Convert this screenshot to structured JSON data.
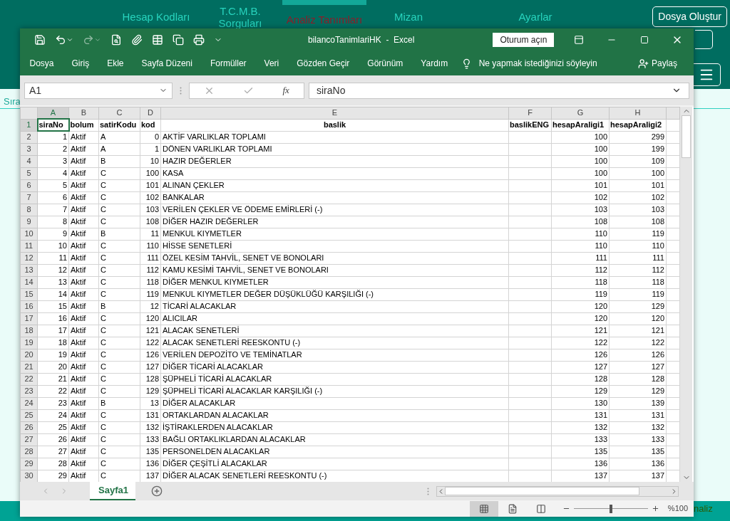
{
  "background_app": {
    "nav": [
      {
        "label": "Hesap Kodları",
        "selected": false
      },
      {
        "label": "T.C.M.B. Sorguları",
        "selected": false
      },
      {
        "label": "Analiz Tanımları",
        "selected": true
      },
      {
        "label": "Mizan",
        "selected": false
      },
      {
        "label": "Ayarlar",
        "selected": false
      }
    ],
    "create_button": "Dosya Oluştur",
    "side_text": "Sıra",
    "bottom_text": "naliz"
  },
  "window": {
    "title": "bilancoTanimlariHK  -  Excel",
    "sign_in": "Oturum açın",
    "ribbon_tabs": [
      "Dosya",
      "Giriş",
      "Ekle",
      "Sayfa Düzeni",
      "Formüller",
      "Veri",
      "Gözden Geçir",
      "Görünüm",
      "Yardım"
    ],
    "tell_me": "Ne yapmak istediğinizi söyleyin",
    "share": "Paylaş"
  },
  "formula_bar": {
    "name_box": "A1",
    "function_button": "fx",
    "value": "siraNo"
  },
  "sheet": {
    "header_row": {
      "num": "1",
      "selected": true
    },
    "columns": [
      {
        "letter": "A",
        "heading": "siraNo",
        "kind": "number",
        "selected": true
      },
      {
        "letter": "B",
        "heading": "bolum",
        "kind": "text",
        "selected": false
      },
      {
        "letter": "C",
        "heading": "satirKodu",
        "kind": "text",
        "selected": false
      },
      {
        "letter": "D",
        "heading": "kod",
        "kind": "number",
        "selected": false
      },
      {
        "letter": "E",
        "heading": "baslik",
        "kind": "title",
        "selected": false
      },
      {
        "letter": "F",
        "heading": "baslikENG",
        "kind": "text",
        "selected": false
      },
      {
        "letter": "G",
        "heading": "hesapAraligi1",
        "kind": "number",
        "selected": false
      },
      {
        "letter": "H",
        "heading": "hesapAraligi2",
        "kind": "number",
        "selected": false
      }
    ],
    "rows": [
      {
        "num": "2",
        "cells": [
          "1",
          "Aktif",
          "A",
          "0",
          "AKTİF VARLIKLAR TOPLAMI",
          null,
          "100",
          "299"
        ]
      },
      {
        "num": "3",
        "cells": [
          "2",
          "Aktif",
          "A",
          "1",
          "DÖNEN VARLIKLAR TOPLAMI",
          null,
          "100",
          "199"
        ]
      },
      {
        "num": "4",
        "cells": [
          "3",
          "Aktif",
          "B",
          "10",
          "HAZIR DEĞERLER",
          null,
          "100",
          "109"
        ]
      },
      {
        "num": "5",
        "cells": [
          "4",
          "Aktif",
          "C",
          "100",
          "KASA",
          null,
          "100",
          "100"
        ]
      },
      {
        "num": "6",
        "cells": [
          "5",
          "Aktif",
          "C",
          "101",
          "ALINAN ÇEKLER",
          null,
          "101",
          "101"
        ]
      },
      {
        "num": "7",
        "cells": [
          "6",
          "Aktif",
          "C",
          "102",
          "BANKALAR",
          null,
          "102",
          "102"
        ]
      },
      {
        "num": "8",
        "cells": [
          "7",
          "Aktif",
          "C",
          "103",
          "VERİLEN ÇEKLER VE ÖDEME EMİRLERİ (-)",
          null,
          "103",
          "103"
        ]
      },
      {
        "num": "9",
        "cells": [
          "8",
          "Aktif",
          "C",
          "108",
          "DİĞER HAZIR DEĞERLER",
          null,
          "108",
          "108"
        ]
      },
      {
        "num": "10",
        "cells": [
          "9",
          "Aktif",
          "B",
          "11",
          "MENKUL KIYMETLER",
          null,
          "110",
          "119"
        ]
      },
      {
        "num": "11",
        "cells": [
          "10",
          "Aktif",
          "C",
          "110",
          "HİSSE SENETLERİ",
          null,
          "110",
          "110"
        ]
      },
      {
        "num": "12",
        "cells": [
          "11",
          "Aktif",
          "C",
          "111",
          "ÖZEL KESİM TAHVİL, SENET VE BONOLARI",
          null,
          "111",
          "111"
        ]
      },
      {
        "num": "13",
        "cells": [
          "12",
          "Aktif",
          "C",
          "112",
          "KAMU KESİMİ TAHVİL, SENET VE BONOLARI",
          null,
          "112",
          "112"
        ]
      },
      {
        "num": "14",
        "cells": [
          "13",
          "Aktif",
          "C",
          "118",
          "DİĞER MENKUL KIYMETLER",
          null,
          "118",
          "118"
        ]
      },
      {
        "num": "15",
        "cells": [
          "14",
          "Aktif",
          "C",
          "119",
          "MENKUL KIYMETLER DEĞER DÜŞÜKLÜĞÜ KARŞILIĞI (-)",
          null,
          "119",
          "119"
        ]
      },
      {
        "num": "16",
        "cells": [
          "15",
          "Aktif",
          "B",
          "12",
          "TİCARİ ALACAKLAR",
          null,
          "120",
          "129"
        ]
      },
      {
        "num": "17",
        "cells": [
          "16",
          "Aktif",
          "C",
          "120",
          "ALICILAR",
          null,
          "120",
          "120"
        ]
      },
      {
        "num": "18",
        "cells": [
          "17",
          "Aktif",
          "C",
          "121",
          "ALACAK SENETLERİ",
          null,
          "121",
          "121"
        ]
      },
      {
        "num": "19",
        "cells": [
          "18",
          "Aktif",
          "C",
          "122",
          "ALACAK SENETLERİ REESKONTU (-)",
          null,
          "122",
          "122"
        ]
      },
      {
        "num": "20",
        "cells": [
          "19",
          "Aktif",
          "C",
          "126",
          "VERİLEN DEPOZİTO VE TEMİNATLAR",
          null,
          "126",
          "126"
        ]
      },
      {
        "num": "21",
        "cells": [
          "20",
          "Aktif",
          "C",
          "127",
          "DİĞER TİCARİ ALACAKLAR",
          null,
          "127",
          "127"
        ]
      },
      {
        "num": "22",
        "cells": [
          "21",
          "Aktif",
          "C",
          "128",
          "ŞÜPHELİ TİCARİ ALACAKLAR",
          null,
          "128",
          "128"
        ]
      },
      {
        "num": "23",
        "cells": [
          "22",
          "Aktif",
          "C",
          "129",
          "ŞÜPHELİ TİCARİ ALACAKLAR KARŞILIĞI (-)",
          null,
          "129",
          "129"
        ]
      },
      {
        "num": "24",
        "cells": [
          "23",
          "Aktif",
          "B",
          "13",
          "DİĞER ALACAKLAR",
          null,
          "130",
          "139"
        ]
      },
      {
        "num": "25",
        "cells": [
          "24",
          "Aktif",
          "C",
          "131",
          "ORTAKLARDAN ALACAKLAR",
          null,
          "131",
          "131"
        ]
      },
      {
        "num": "26",
        "cells": [
          "25",
          "Aktif",
          "C",
          "132",
          "İŞTİRAKLERDEN ALACAKLAR",
          null,
          "132",
          "132"
        ]
      },
      {
        "num": "27",
        "cells": [
          "26",
          "Aktif",
          "C",
          "133",
          "BAĞLI ORTAKLIKLARDAN ALACAKLAR",
          null,
          "133",
          "133"
        ]
      },
      {
        "num": "28",
        "cells": [
          "27",
          "Aktif",
          "C",
          "135",
          "PERSONELDEN ALACAKLAR",
          null,
          "135",
          "135"
        ]
      },
      {
        "num": "29",
        "cells": [
          "28",
          "Aktif",
          "C",
          "136",
          "DİĞER ÇEŞİTLİ ALACAKLAR",
          null,
          "136",
          "136"
        ]
      },
      {
        "num": "30",
        "cells": [
          "29",
          "Aktif",
          "C",
          "137",
          "DİĞER ALACAK SENETLERİ REESKONTU (-)",
          null,
          "137",
          "137"
        ]
      }
    ]
  },
  "sheet_tabs": [
    {
      "label": "Sayfa1",
      "selected": true
    }
  ],
  "status_bar": {
    "views": [
      {
        "kind": "normal",
        "selected": true
      },
      {
        "kind": "page-layout",
        "selected": false
      },
      {
        "kind": "page-break",
        "selected": false
      }
    ],
    "zoom": {
      "level": 0.5,
      "reading": "%100"
    }
  }
}
